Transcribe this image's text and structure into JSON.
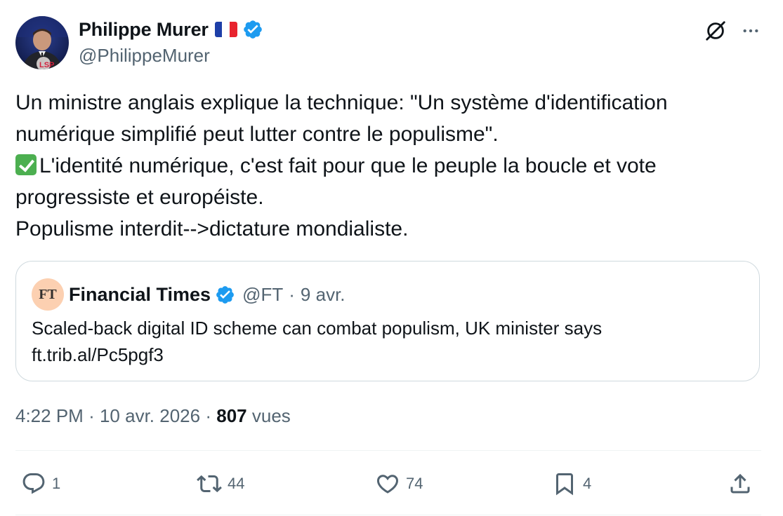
{
  "author": {
    "display_name": "Philippe Murer",
    "handle": "@PhilippeMurer",
    "flag": "fr-flag",
    "verified": true
  },
  "header_icons": [
    "grok-icon",
    "more-icon"
  ],
  "post": {
    "line1": "Un ministre anglais explique la technique: \"Un système d'identification",
    "line2": "numérique simplifié peut lutter contre le populisme\".",
    "line3": "L'identité numérique, c'est fait pour que le peuple la boucle et vote",
    "line4": "progressiste et européiste.",
    "line5": "Populisme interdit-->dictature mondialiste."
  },
  "quote": {
    "logo_text": "FT",
    "name": "Financial Times",
    "handle": "@FT",
    "separator": "·",
    "date": "9 avr.",
    "text": "Scaled-back digital ID scheme can combat populism, UK minister says",
    "link": "ft.trib.al/Pc5pgf3"
  },
  "meta": {
    "time": "4:22 PM",
    "separator": "·",
    "date": "10 avr. 2026",
    "views_count": "807",
    "views_label": "vues"
  },
  "actions": {
    "replies": "1",
    "reposts": "44",
    "likes": "74",
    "bookmarks": "4"
  },
  "colors": {
    "text": "#0f1419",
    "secondary": "#536471",
    "verified": "#1d9bf0",
    "border": "#cfd9de",
    "ft_logo_bg": "#fcd0b1"
  }
}
